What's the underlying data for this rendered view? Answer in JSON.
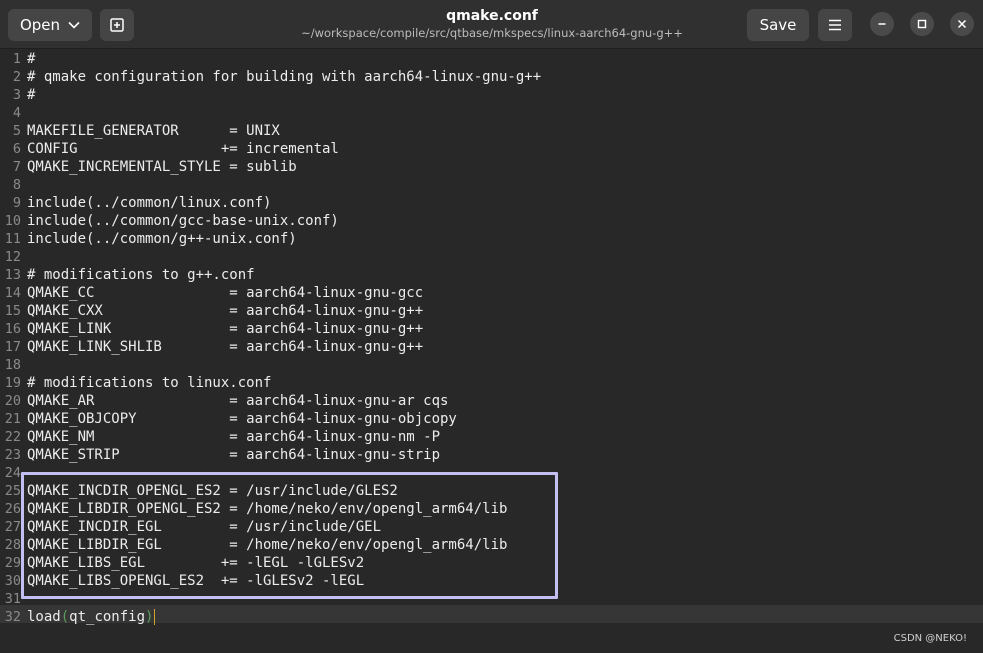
{
  "header": {
    "open_label": "Open",
    "save_label": "Save",
    "title": "qmake.conf",
    "subtitle": "~/workspace/compile/src/qtbase/mkspecs/linux-aarch64-gnu-g++"
  },
  "editor": {
    "lines": [
      {
        "n": "1",
        "text": "#"
      },
      {
        "n": "2",
        "text": "# qmake configuration for building with aarch64-linux-gnu-g++"
      },
      {
        "n": "3",
        "text": "#"
      },
      {
        "n": "4",
        "text": ""
      },
      {
        "n": "5",
        "text": "MAKEFILE_GENERATOR      = UNIX"
      },
      {
        "n": "6",
        "text": "CONFIG                 += incremental"
      },
      {
        "n": "7",
        "text": "QMAKE_INCREMENTAL_STYLE = sublib"
      },
      {
        "n": "8",
        "text": ""
      },
      {
        "n": "9",
        "text": "include(../common/linux.conf)"
      },
      {
        "n": "10",
        "text": "include(../common/gcc-base-unix.conf)"
      },
      {
        "n": "11",
        "text": "include(../common/g++-unix.conf)"
      },
      {
        "n": "12",
        "text": ""
      },
      {
        "n": "13",
        "text": "# modifications to g++.conf"
      },
      {
        "n": "14",
        "text": "QMAKE_CC                = aarch64-linux-gnu-gcc"
      },
      {
        "n": "15",
        "text": "QMAKE_CXX               = aarch64-linux-gnu-g++"
      },
      {
        "n": "16",
        "text": "QMAKE_LINK              = aarch64-linux-gnu-g++"
      },
      {
        "n": "17",
        "text": "QMAKE_LINK_SHLIB        = aarch64-linux-gnu-g++"
      },
      {
        "n": "18",
        "text": ""
      },
      {
        "n": "19",
        "text": "# modifications to linux.conf"
      },
      {
        "n": "20",
        "text": "QMAKE_AR                = aarch64-linux-gnu-ar cqs"
      },
      {
        "n": "21",
        "text": "QMAKE_OBJCOPY           = aarch64-linux-gnu-objcopy"
      },
      {
        "n": "22",
        "text": "QMAKE_NM                = aarch64-linux-gnu-nm -P"
      },
      {
        "n": "23",
        "text": "QMAKE_STRIP             = aarch64-linux-gnu-strip"
      },
      {
        "n": "24",
        "text": ""
      },
      {
        "n": "25",
        "text": "QMAKE_INCDIR_OPENGL_ES2 = /usr/include/GLES2"
      },
      {
        "n": "26",
        "text": "QMAKE_LIBDIR_OPENGL_ES2 = /home/neko/env/opengl_arm64/lib"
      },
      {
        "n": "27",
        "text": "QMAKE_INCDIR_EGL        = /usr/include/GEL"
      },
      {
        "n": "28",
        "text": "QMAKE_LIBDIR_EGL        = /home/neko/env/opengl_arm64/lib"
      },
      {
        "n": "29",
        "text": "QMAKE_LIBS_EGL         += -lEGL -lGLESv2"
      },
      {
        "n": "30",
        "text": "QMAKE_LIBS_OPENGL_ES2  += -lGLESv2 -lEGL"
      },
      {
        "n": "31",
        "text": ""
      }
    ],
    "last_line": {
      "n": "32",
      "pre": "load",
      "open": "(",
      "arg": "qt_config",
      "close": ")"
    }
  },
  "watermark": "CSDN @NEKO!",
  "colors": {
    "accent_box": "#c3bff0",
    "paren_match": "#5b9e5b",
    "cursor": "#d1a32b"
  }
}
